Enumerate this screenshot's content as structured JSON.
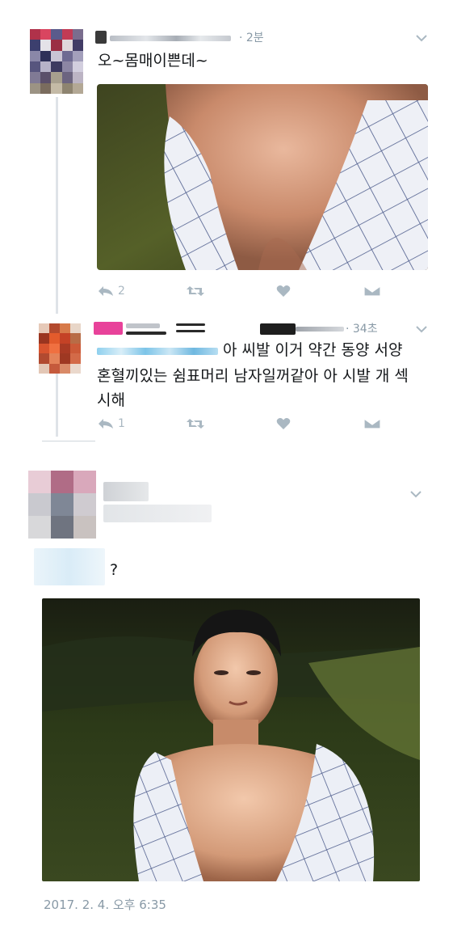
{
  "tweets": [
    {
      "time": "· 2분",
      "text": "오~몸매이쁜데~",
      "actions": {
        "reply_count": "2",
        "retweet_count": "",
        "like_count": ""
      }
    },
    {
      "time": "· 34초",
      "text_line1": "아 씨발 이거 약간 동양 서양",
      "text_line2": "혼혈끼있는 쉼표머리 남자일꺼같아 아 시발 개 섹",
      "text_line3": "시해",
      "actions": {
        "reply_count": "1",
        "retweet_count": "",
        "like_count": ""
      }
    }
  ],
  "main_tweet": {
    "text": "?",
    "date": "2017. 2. 4. 오후 6:35"
  },
  "colors": {
    "icon_gray": "#aab8c2",
    "meta_gray": "#8899a6",
    "thread_line": "#dfe3e8",
    "redaction_pink": "#e8429a"
  },
  "icons": [
    "reply-icon",
    "retweet-icon",
    "like-icon",
    "dm-icon",
    "chevron-down-icon"
  ]
}
